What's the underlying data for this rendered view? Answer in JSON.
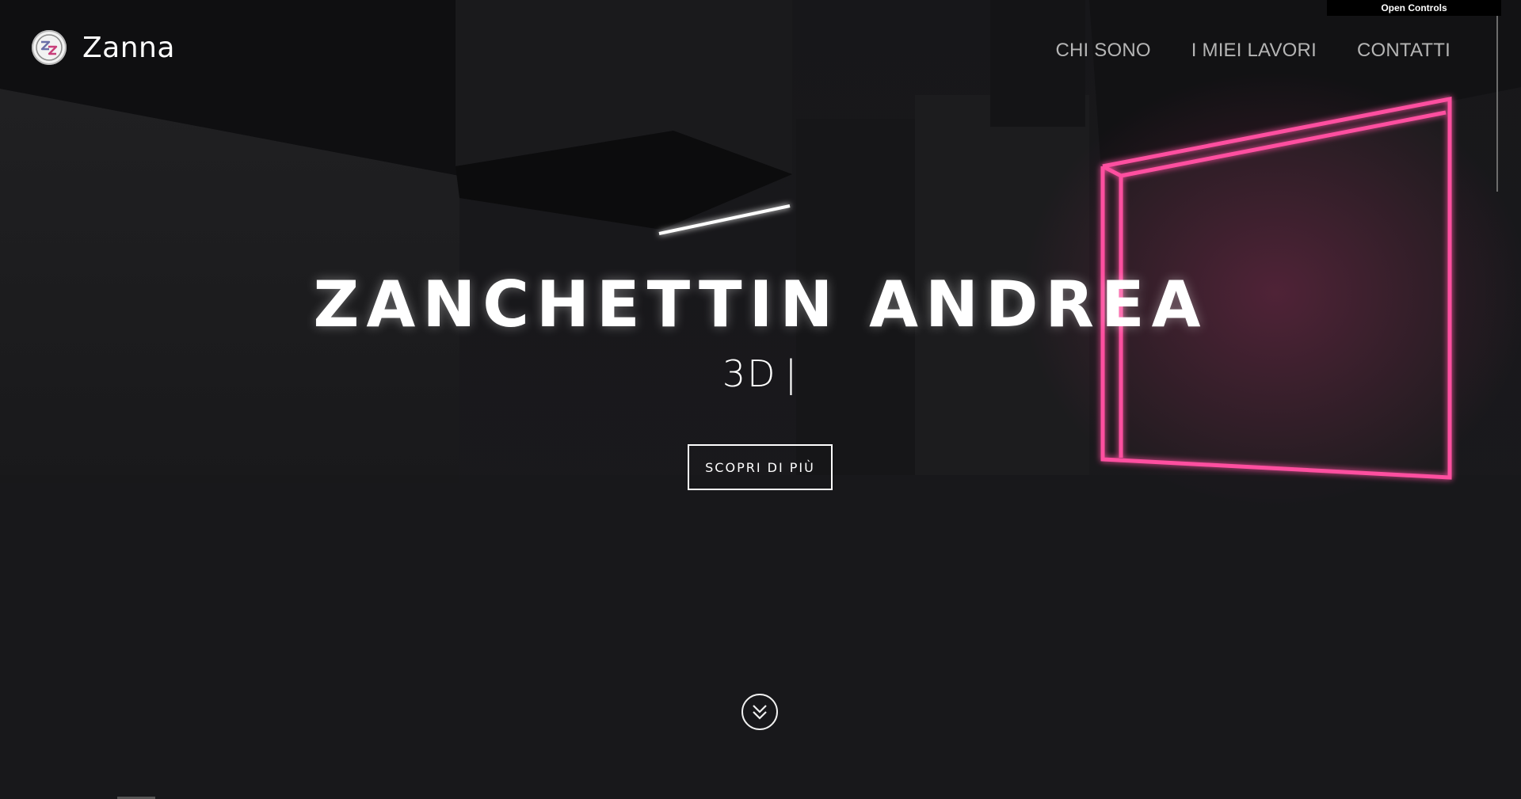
{
  "brand": {
    "name": "Zanna",
    "badge_icon": "zz-monogram-icon"
  },
  "nav": {
    "items": [
      {
        "label": "CHI SONO"
      },
      {
        "label": "I MIEI LAVORI"
      },
      {
        "label": "CONTATTI"
      }
    ]
  },
  "controls": {
    "label": "Open Controls"
  },
  "hero": {
    "title": "ZANCHETTIN ANDREA",
    "subtitle": "3D",
    "cursor": "|",
    "cta_label": "SCOPRI DI PIÙ",
    "scroll_icon": "double-chevron-down-icon"
  },
  "colors": {
    "background": "#141416",
    "neon_pink": "#ff4fa0",
    "text": "#ffffff",
    "nav_text": "#b5b5b5"
  }
}
